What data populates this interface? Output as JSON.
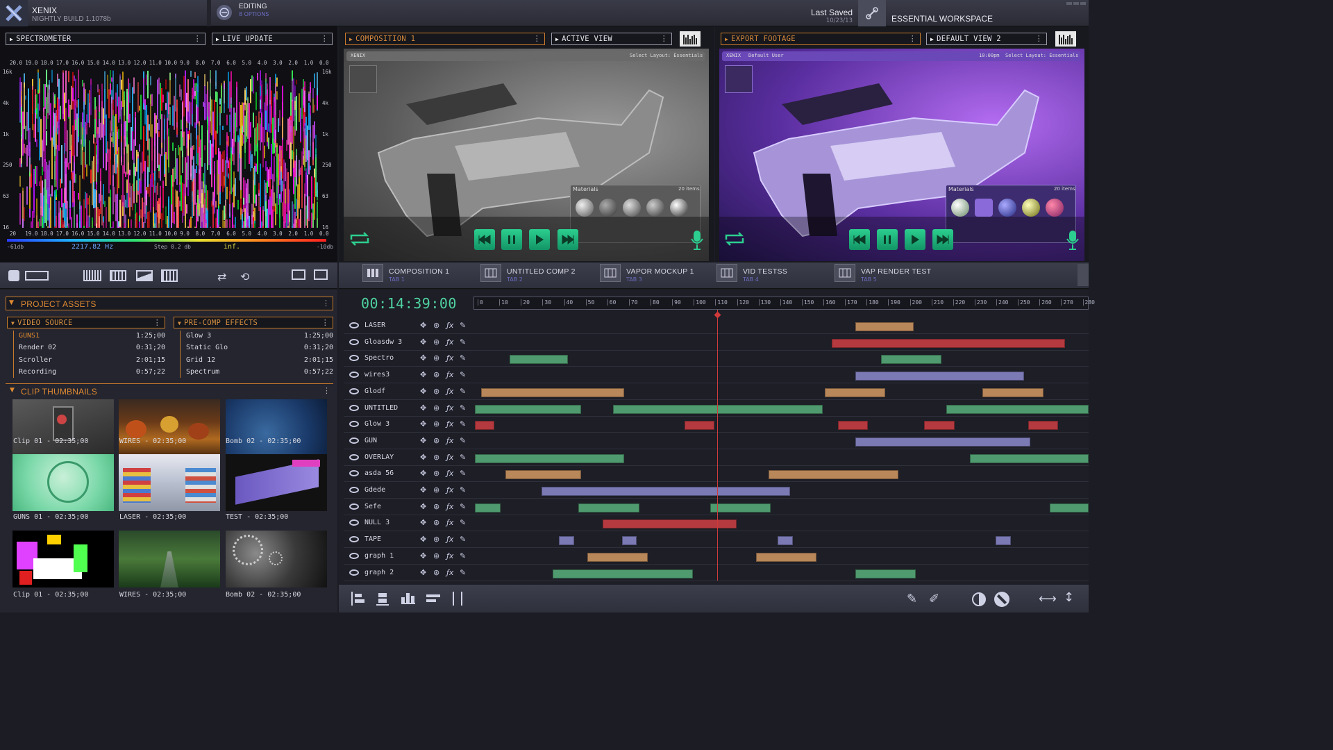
{
  "app": {
    "name": "XENIX",
    "build": "NIGHTLY BUILD 1.1078b"
  },
  "mode": {
    "label": "EDITING",
    "sub": "8 OPTIONS"
  },
  "save": {
    "label": "Last Saved",
    "date": "10/23/13"
  },
  "workspace": {
    "label": "ESSENTIAL WORKSPACE"
  },
  "spectrometer": {
    "dropdown1": "SPECTROMETER",
    "dropdown2": "LIVE UPDATE",
    "top_ticks": [
      "20.0",
      "19.0",
      "18.0",
      "17.0",
      "16.0",
      "15.0",
      "14.0",
      "13.0",
      "12.0",
      "11.0",
      "10.0",
      "9.0",
      "8.0",
      "7.0",
      "6.0",
      "5.0",
      "4.0",
      "3.0",
      "2.0",
      "1.0",
      "0.0"
    ],
    "bottom_ticks": [
      "20",
      "19.0",
      "18.0",
      "17.0",
      "16.0",
      "15.0",
      "14.0",
      "13.0",
      "12.0",
      "11.0",
      "10.0",
      "9.0",
      "8.0",
      "7.0",
      "6.0",
      "5.0",
      "4.0",
      "3.0",
      "2.0",
      "1.0",
      "0.0"
    ],
    "left_ticks": [
      "16k",
      "4k",
      "1k",
      "250",
      "63",
      "16"
    ],
    "right_ticks": [
      "16k",
      "4k",
      "1k",
      "250",
      "63",
      "16"
    ],
    "min_db": "-61db",
    "freq": "2217.82 Hz",
    "step": "Step 0.2 db",
    "inf": "inf.",
    "max_db": "-10db"
  },
  "view1": {
    "dropdown1": "COMPOSITION 1",
    "dropdown2": "ACTIVE VIEW",
    "mini_app": "XENIX",
    "mini_layout": "Select Layout: Essentials",
    "materials": "Materials",
    "items": "20 items"
  },
  "view2": {
    "dropdown1": "EXPORT FOOTAGE",
    "dropdown2": "DEFAULT VIEW 2",
    "mini_app": "XENIX",
    "mini_user": "Default User",
    "mini_time": "10:00pm",
    "mini_layout": "Select Layout: Essentials",
    "materials": "Materials",
    "items": "20 items"
  },
  "tabs": [
    {
      "title": "COMPOSITION 1",
      "sub": "TAB 1"
    },
    {
      "title": "UNTITLED COMP 2",
      "sub": "TAB 2"
    },
    {
      "title": "VAPOR MOCKUP 1",
      "sub": "TAB 3"
    },
    {
      "title": "VID TESTSS",
      "sub": "TAB 4"
    },
    {
      "title": "VAP RENDER TEST",
      "sub": "TAB 5"
    }
  ],
  "project_assets": {
    "title": "PROJECT ASSETS",
    "video_source": {
      "title": "VIDEO SOURCE",
      "items": [
        {
          "name": "GUNS1",
          "time": "1:25;00"
        },
        {
          "name": "Render 02",
          "time": "0:31;20"
        },
        {
          "name": "Scroller",
          "time": "2:01;15"
        },
        {
          "name": "Recording",
          "time": "0:57;22"
        }
      ]
    },
    "precomp": {
      "title": "PRE-COMP EFFECTS",
      "items": [
        {
          "name": "Glow 3",
          "time": "1:25;00"
        },
        {
          "name": "Static Glo",
          "time": "0:31;20"
        },
        {
          "name": "Grid 12",
          "time": "2:01;15"
        },
        {
          "name": "Spectrum",
          "time": "0:57;22"
        }
      ]
    }
  },
  "clip_thumbnails": {
    "title": "CLIP THUMBNAILS",
    "clips": [
      "Clip 01 - 02:35;00",
      "WIRES - 02:35;00",
      "Bomb 02 - 02:35;00",
      "GUNS 01 - 02:35;00",
      "LASER - 02:35;00",
      "TEST - 02:35;00",
      "Clip 01 - 02:35;00",
      "WIRES - 02:35;00",
      "Bomb 02 - 02:35;00"
    ]
  },
  "timeline": {
    "timecode": "00:14:39:00",
    "ruler": [
      "0",
      "10",
      "20",
      "30",
      "40",
      "50",
      "60",
      "70",
      "80",
      "90",
      "100",
      "110",
      "120",
      "130",
      "140",
      "150",
      "160",
      "170",
      "180",
      "190",
      "200",
      "210",
      "220",
      "230",
      "240",
      "250",
      "260",
      "270",
      "280"
    ],
    "playhead": 112,
    "tracks": [
      {
        "name": "LASER",
        "segments": [
          {
            "start": 176,
            "end": 203,
            "color": "orange"
          }
        ]
      },
      {
        "name": "Gloasdw 3",
        "segments": [
          {
            "start": 165,
            "end": 273,
            "color": "red"
          }
        ]
      },
      {
        "name": "Spectro",
        "segments": [
          {
            "start": 16,
            "end": 43,
            "color": "green"
          },
          {
            "start": 188,
            "end": 216,
            "color": "green"
          }
        ]
      },
      {
        "name": "wires3",
        "segments": [
          {
            "start": 176,
            "end": 254,
            "color": "purple"
          }
        ]
      },
      {
        "name": "Glodf",
        "segments": [
          {
            "start": 3,
            "end": 69,
            "color": "orange"
          },
          {
            "start": 162,
            "end": 190,
            "color": "orange"
          },
          {
            "start": 235,
            "end": 263,
            "color": "orange"
          }
        ]
      },
      {
        "name": "UNTITLED",
        "segments": [
          {
            "start": 0,
            "end": 49,
            "color": "green"
          },
          {
            "start": 64,
            "end": 161,
            "color": "green"
          },
          {
            "start": 218,
            "end": 284,
            "color": "green"
          }
        ]
      },
      {
        "name": "Glow 3",
        "segments": [
          {
            "start": 0,
            "end": 9,
            "color": "red"
          },
          {
            "start": 97,
            "end": 111,
            "color": "red"
          },
          {
            "start": 168,
            "end": 182,
            "color": "red"
          },
          {
            "start": 208,
            "end": 222,
            "color": "red"
          },
          {
            "start": 256,
            "end": 270,
            "color": "red"
          }
        ]
      },
      {
        "name": "GUN",
        "segments": [
          {
            "start": 176,
            "end": 257,
            "color": "purple"
          }
        ]
      },
      {
        "name": "OVERLAY",
        "segments": [
          {
            "start": 0,
            "end": 69,
            "color": "green"
          },
          {
            "start": 229,
            "end": 284,
            "color": "green"
          }
        ]
      },
      {
        "name": "asda 56",
        "segments": [
          {
            "start": 14,
            "end": 49,
            "color": "orange"
          },
          {
            "start": 136,
            "end": 196,
            "color": "orange"
          }
        ]
      },
      {
        "name": "Gdede",
        "segments": [
          {
            "start": 31,
            "end": 146,
            "color": "purple"
          }
        ]
      },
      {
        "name": "Sefe",
        "segments": [
          {
            "start": 0,
            "end": 12,
            "color": "green"
          },
          {
            "start": 48,
            "end": 76,
            "color": "green"
          },
          {
            "start": 109,
            "end": 137,
            "color": "green"
          },
          {
            "start": 266,
            "end": 284,
            "color": "green"
          }
        ]
      },
      {
        "name": "NULL 3",
        "segments": [
          {
            "start": 59,
            "end": 121,
            "color": "red"
          }
        ]
      },
      {
        "name": "TAPE",
        "segments": [
          {
            "start": 39,
            "end": 46,
            "color": "purple"
          },
          {
            "start": 68,
            "end": 75,
            "color": "purple"
          },
          {
            "start": 140,
            "end": 147,
            "color": "purple"
          },
          {
            "start": 241,
            "end": 248,
            "color": "purple"
          }
        ]
      },
      {
        "name": "graph 1",
        "segments": [
          {
            "start": 52,
            "end": 80,
            "color": "orange"
          },
          {
            "start": 130,
            "end": 158,
            "color": "orange"
          }
        ]
      },
      {
        "name": "graph 2",
        "segments": [
          {
            "start": 36,
            "end": 101,
            "color": "green"
          },
          {
            "start": 176,
            "end": 204,
            "color": "green"
          }
        ]
      }
    ]
  },
  "colors": {
    "orange": "#b8875a",
    "red": "#b53a40",
    "green": "#4f9a6e",
    "purple": "#7c7ab5",
    "accent": "#e08a32",
    "ctrl": "#1fb57c"
  }
}
